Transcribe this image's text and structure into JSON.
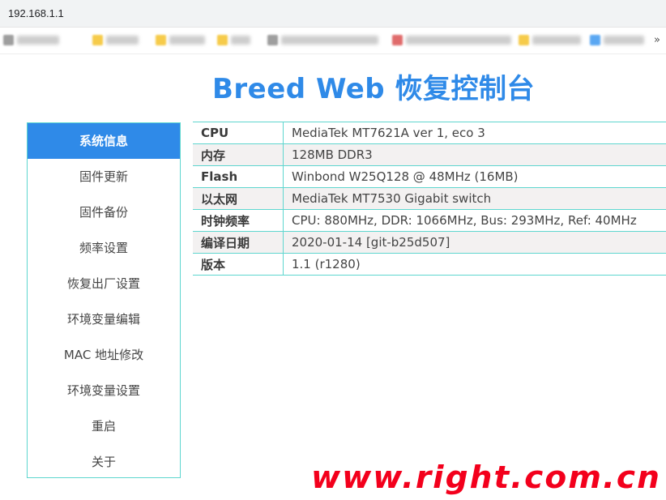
{
  "browser": {
    "url": "192.168.1.1"
  },
  "title": "Breed Web 恢复控制台",
  "sidebar": {
    "items": [
      {
        "label": "系统信息",
        "active": true
      },
      {
        "label": "固件更新"
      },
      {
        "label": "固件备份"
      },
      {
        "label": "频率设置"
      },
      {
        "label": "恢复出厂设置"
      },
      {
        "label": "环境变量编辑"
      },
      {
        "label": "MAC 地址修改"
      },
      {
        "label": "环境变量设置"
      },
      {
        "label": "重启"
      },
      {
        "label": "关于"
      }
    ]
  },
  "info": {
    "rows": [
      {
        "key": "CPU",
        "value": "MediaTek MT7621A ver 1, eco 3"
      },
      {
        "key": "内存",
        "value": "128MB DDR3"
      },
      {
        "key": "Flash",
        "value": "Winbond W25Q128 @ 48MHz (16MB)"
      },
      {
        "key": "以太网",
        "value": "MediaTek MT7530 Gigabit switch"
      },
      {
        "key": "时钟频率",
        "value": "CPU: 880MHz, DDR: 1066MHz, Bus: 293MHz, Ref: 40MHz"
      },
      {
        "key": "编译日期",
        "value": "2020-01-14 [git-b25d507]"
      },
      {
        "key": "版本",
        "value": "1.1 (r1280)"
      }
    ]
  },
  "watermark": "www.right.com.cn",
  "colors": {
    "accent": "#2f8ae8",
    "border": "#5ed6cf",
    "watermark": "#f3001c"
  }
}
